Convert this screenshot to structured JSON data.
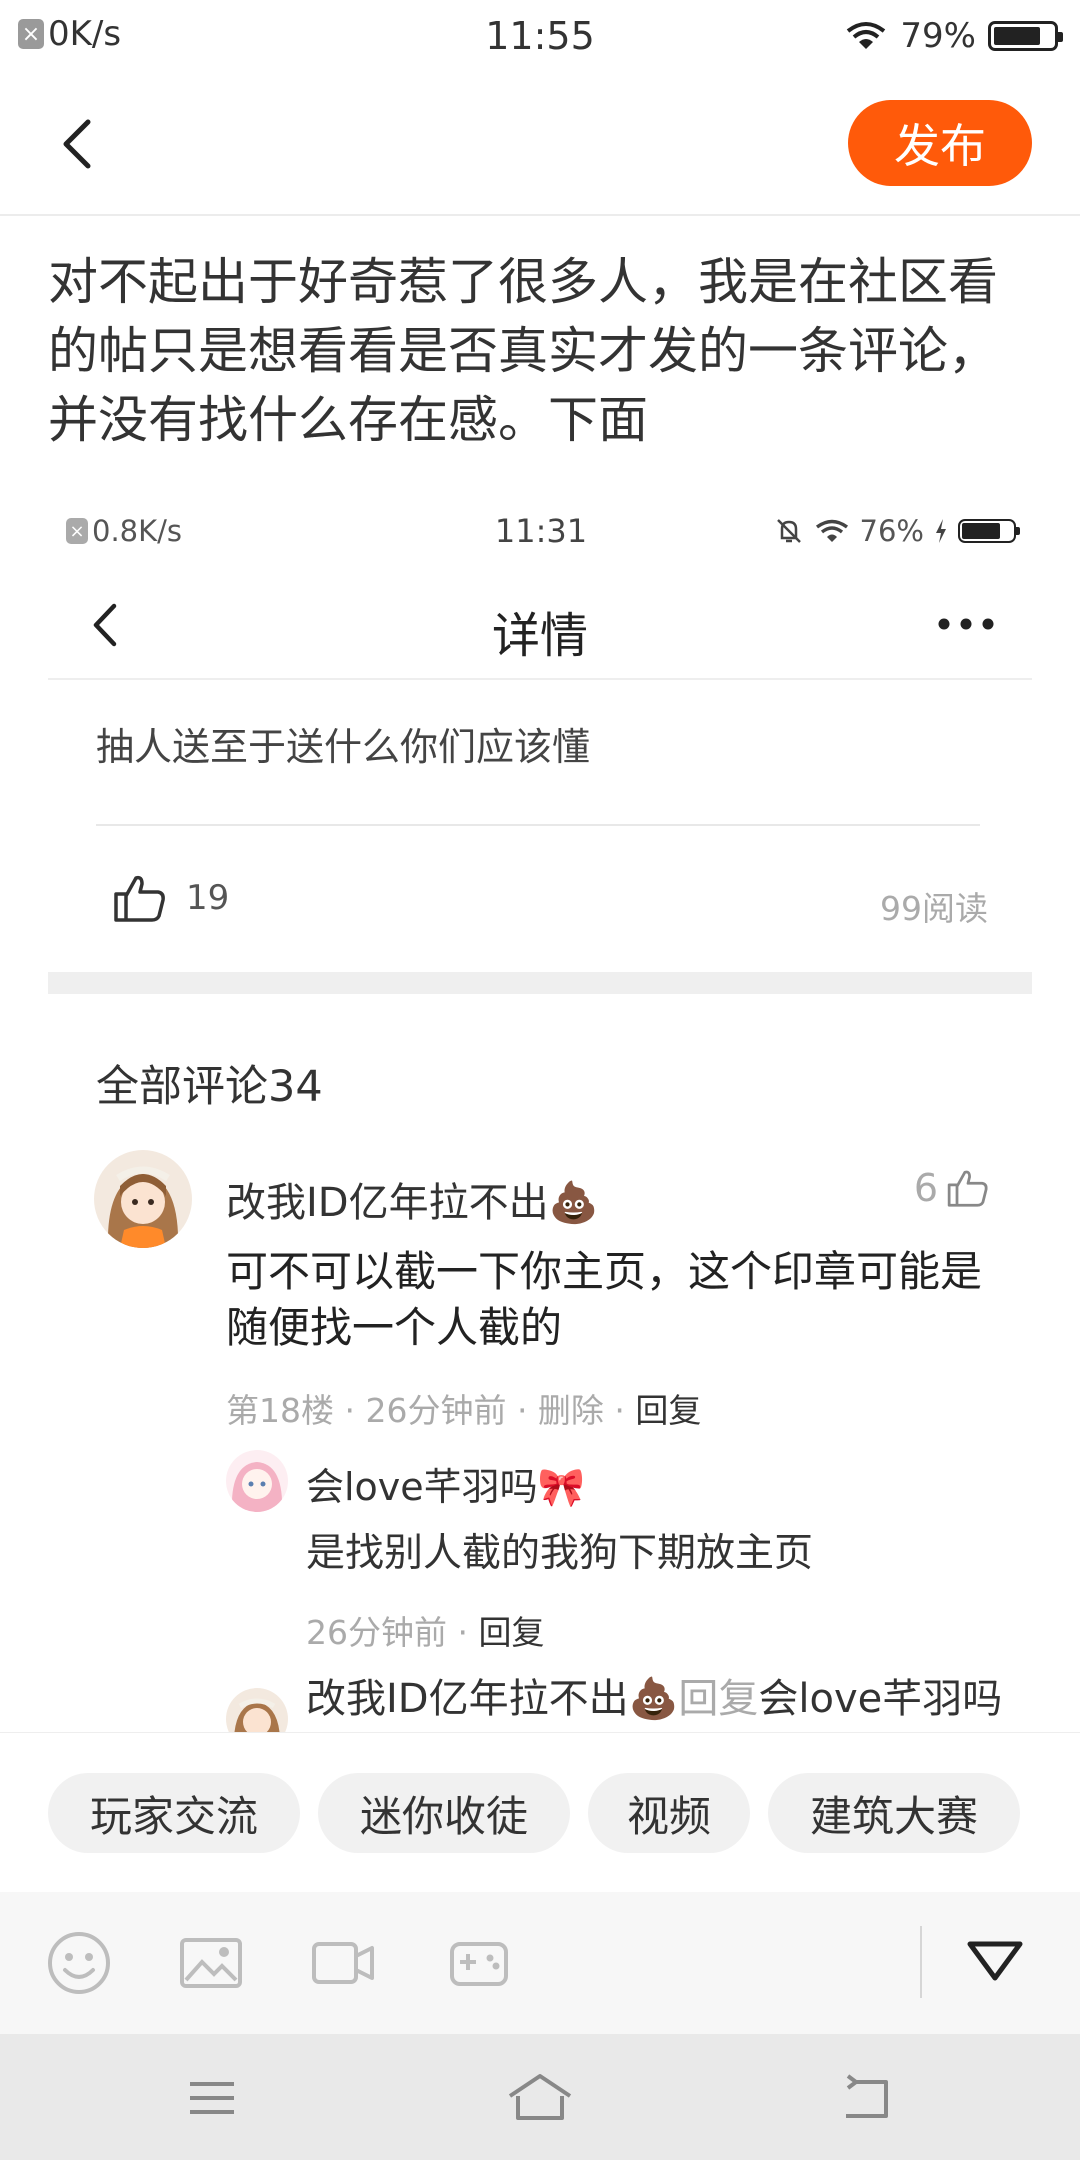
{
  "status_bar": {
    "net_speed": "0K/s",
    "time": "11:55",
    "battery": "79%",
    "battery_level": 0.79
  },
  "topbar": {
    "publish_label": "发布"
  },
  "post": {
    "text": "对不起出于好奇惹了很多人，我是在社区看的帖只是想看看是否真实才发的一条评论，并没有找什么存在感。下面"
  },
  "screenshot": {
    "status_bar": {
      "net_speed": "0.8K/s",
      "time": "11:31",
      "battery": "76%",
      "battery_level": 0.76
    },
    "header": {
      "title": "详情"
    },
    "post_body": "抽人送至于送什么你们应该懂",
    "likes": "19",
    "reads": "99阅读",
    "all_comments": "全部评论34",
    "comment": {
      "name": "改我ID亿年拉不出💩",
      "like_count": "6",
      "text": "可不可以截一下你主页，这个印章可能是随便找一个人截的",
      "meta": "第18楼 · 26分钟前 · 删除 · ",
      "reply_label": "回复"
    },
    "reply1": {
      "name": "会love芊羽吗🎀",
      "text": "是找别人截的我狗下期放主页",
      "meta": "26分钟前 · ",
      "reply_label": "回复"
    },
    "reply2": {
      "name": "改我ID亿年拉不出💩",
      "reply_word": "回复",
      "target": "会love芊羽吗🎀"
    }
  },
  "tags": [
    "玩家交流",
    "迷你收徒",
    "视频",
    "建筑大赛"
  ],
  "toolbar": {
    "icons": [
      "emoji-icon",
      "image-icon",
      "video-icon",
      "gamepad-icon",
      "collapse-icon"
    ]
  },
  "navbar": {
    "icons": [
      "menu-icon",
      "home-icon",
      "back-icon"
    ]
  }
}
